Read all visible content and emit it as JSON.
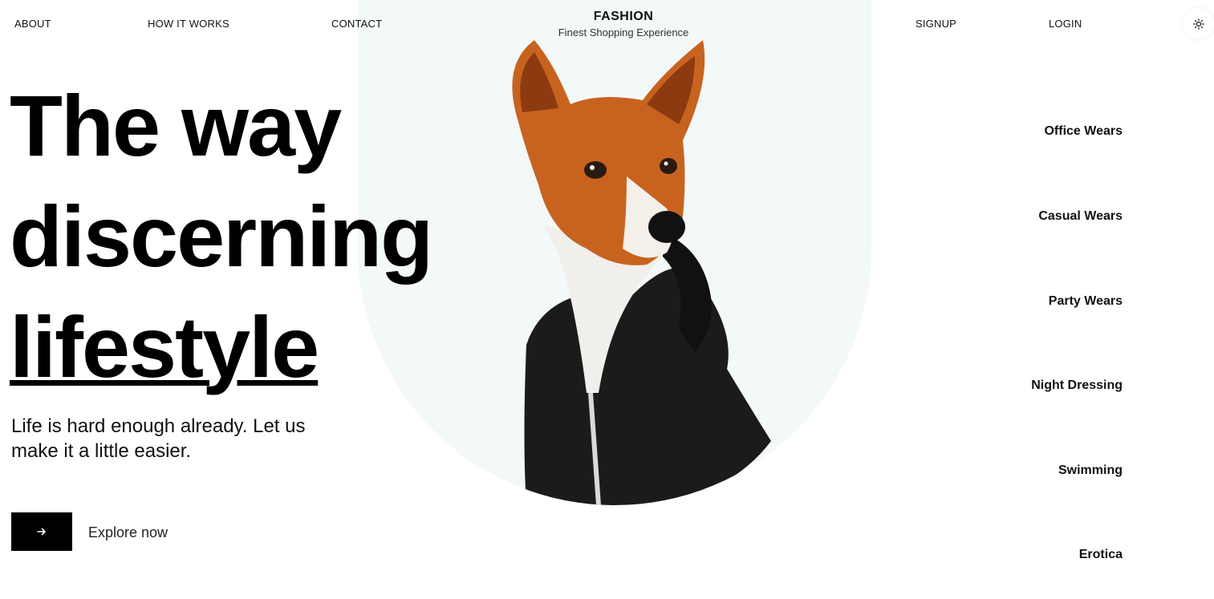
{
  "nav": {
    "about": "ABOUT",
    "how_it_works": "HOW IT WORKS",
    "contact": "CONTACT",
    "signup": "SIGNUP",
    "login": "LOGIN"
  },
  "brand": {
    "title": "FASHION",
    "subtitle": "Finest Shopping Experience"
  },
  "hero": {
    "headline": [
      "The way",
      "discerning",
      "lifestyle"
    ],
    "tagline": "Life is hard enough already. Let us make it a little easier.",
    "cta_label": "Explore now"
  },
  "categories": [
    "Office Wears",
    "Casual Wears",
    "Party Wears",
    "Night Dressing",
    "Swimming",
    "Erotica"
  ],
  "icons": {
    "theme": "sun-icon",
    "cta": "arrow-right-icon"
  },
  "colors": {
    "accent": "#000000",
    "hero_bg": "#f3f8f8",
    "dog_fur": "#c8631f",
    "hoodie": "#1b1b1b"
  }
}
